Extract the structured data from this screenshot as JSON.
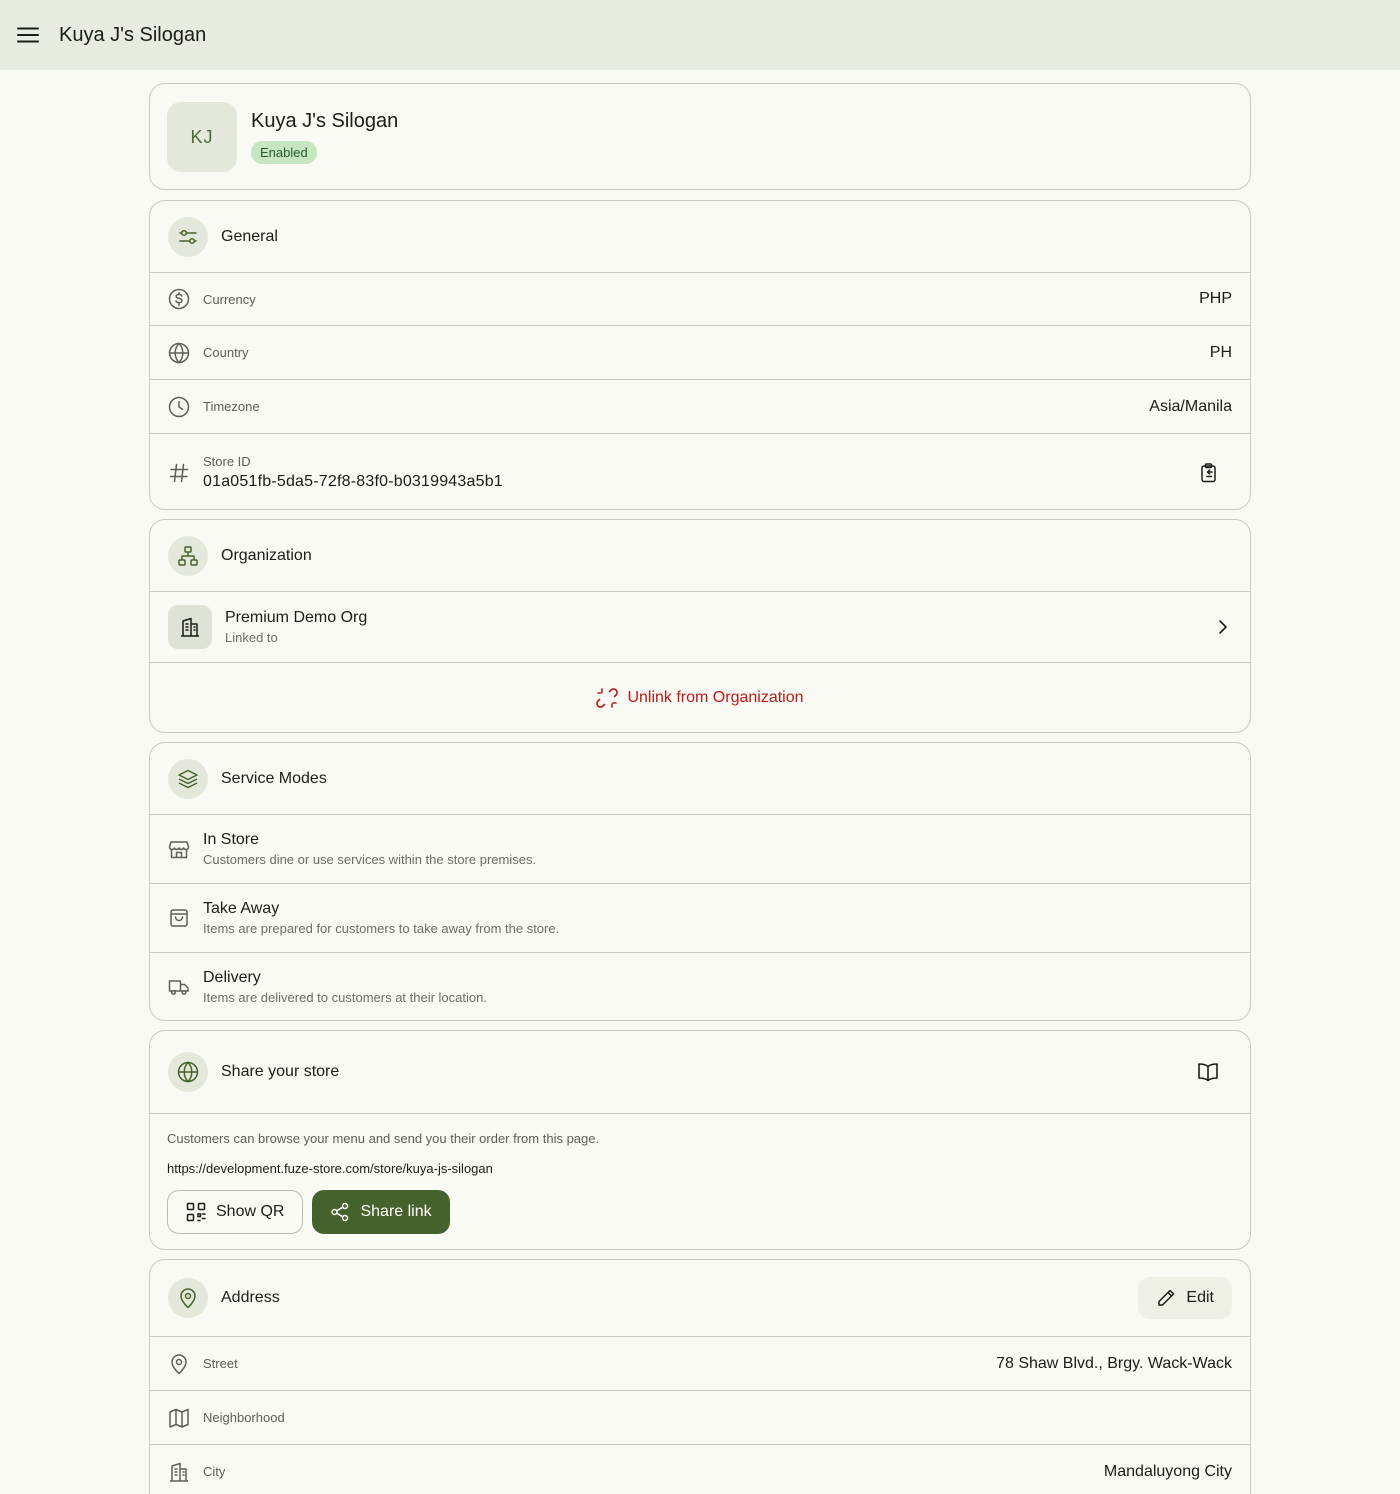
{
  "app": {
    "title": "Kuya J's Silogan"
  },
  "store": {
    "initials": "KJ",
    "name": "Kuya J's Silogan",
    "status": "Enabled"
  },
  "general": {
    "heading": "General",
    "currency_label": "Currency",
    "currency_value": "PHP",
    "country_label": "Country",
    "country_value": "PH",
    "timezone_label": "Timezone",
    "timezone_value": "Asia/Manila",
    "store_id_label": "Store ID",
    "store_id_value": "01a051fb-5da5-72f8-83f0-b0319943a5b1"
  },
  "organization": {
    "heading": "Organization",
    "org_name": "Premium Demo Org",
    "org_sub": "Linked to",
    "unlink_label": "Unlink from Organization"
  },
  "service_modes": {
    "heading": "Service Modes",
    "items": [
      {
        "title": "In Store",
        "desc": "Customers dine or use services within the store premises."
      },
      {
        "title": "Take Away",
        "desc": "Items are prepared for customers to take away from the store."
      },
      {
        "title": "Delivery",
        "desc": "Items are delivered to customers at their location."
      }
    ]
  },
  "share": {
    "heading": "Share your store",
    "description": "Customers can browse your menu and send you their order from this page.",
    "url": "https://development.fuze-store.com/store/kuya-js-silogan",
    "show_qr_label": "Show QR",
    "share_link_label": "Share link"
  },
  "address": {
    "heading": "Address",
    "edit_label": "Edit",
    "street_label": "Street",
    "street_value": "78 Shaw Blvd., Brgy. Wack-Wack",
    "neighborhood_label": "Neighborhood",
    "neighborhood_value": "",
    "city_label": "City",
    "city_value": "Mandaluyong City"
  },
  "colors": {
    "primary": "#46622c",
    "danger": "#ba1a1a",
    "badge_bg": "#c5e6c0",
    "surface": "#f9faf3",
    "topbar": "#e8ebdf"
  }
}
